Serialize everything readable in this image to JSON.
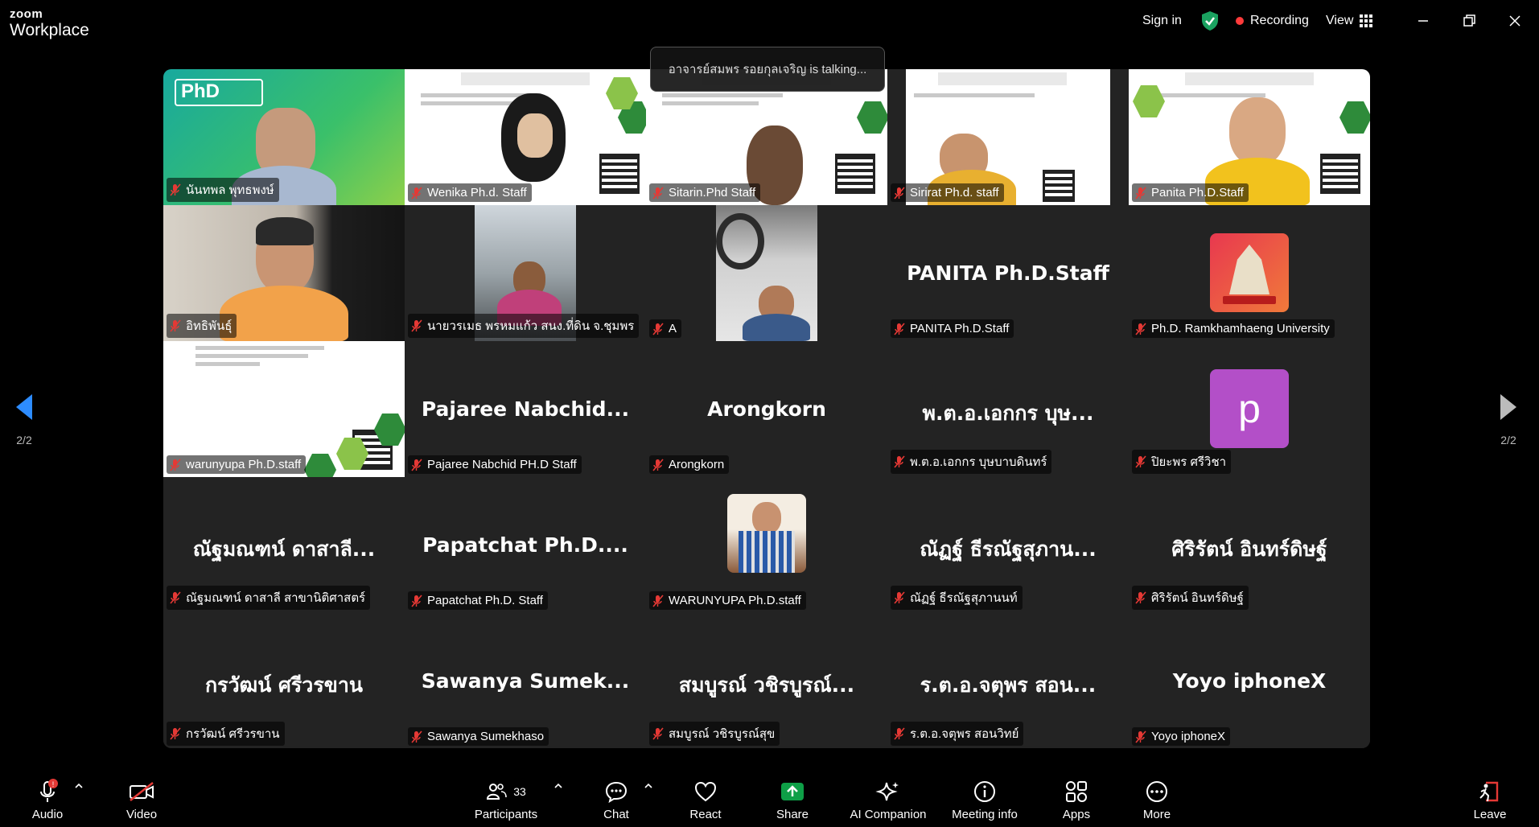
{
  "app": {
    "brand_top": "zoom",
    "brand_bottom": "Workplace"
  },
  "header": {
    "sign_in": "Sign in",
    "recording": "Recording",
    "view": "View"
  },
  "toast": {
    "text": "อาจารย์สมพร รอยกุลเจริญ is talking..."
  },
  "pagination": {
    "left": "2/2",
    "right": "2/2"
  },
  "tiles": [
    {
      "label": "นันทพล พุทธพงษ์",
      "title": ""
    },
    {
      "label": "Wenika Ph.d. Staff",
      "title": ""
    },
    {
      "label": "Sitarin.Phd Staff",
      "title": ""
    },
    {
      "label": "Sirirat Ph.d. staff",
      "title": ""
    },
    {
      "label": "Panita Ph.D.Staff",
      "title": ""
    },
    {
      "label": "อิทธิพันธุ์",
      "title": ""
    },
    {
      "label": "นายวรเมธ พรหมแก้ว สนง.ที่ดิน จ.ชุมพร",
      "title": ""
    },
    {
      "label": "A",
      "title": ""
    },
    {
      "label": "PANITA Ph.D.Staff",
      "title": "PANITA Ph.D.Staff"
    },
    {
      "label": "Ph.D. Ramkhamhaeng University",
      "title": ""
    },
    {
      "label": "warunyupa Ph.D.staff",
      "title": ""
    },
    {
      "label": "Pajaree Nabchid PH.D Staff",
      "title": "Pajaree  Nabchid..."
    },
    {
      "label": "Arongkorn",
      "title": "Arongkorn"
    },
    {
      "label": "พ.ต.อ.เอกกร บุษบาบดินทร์",
      "title": "พ.ต.อ.เอกกร บุษ..."
    },
    {
      "label": "ปิยะพร ศรีวิชา",
      "title": "",
      "avatar_letter": "p"
    },
    {
      "label": "ณัฐมณฑน์ ดาสาลี สาขานิติศาสตร์",
      "title": "ณัฐมณฑน์ ดาสาลี..."
    },
    {
      "label": "Papatchat Ph.D. Staff",
      "title": "Papatchat  Ph.D...."
    },
    {
      "label": "WARUNYUPA Ph.D.staff",
      "title": ""
    },
    {
      "label": "ณัฏฐ์ ธีรณัฐสุภานนท์",
      "title": "ณัฏฐ์  ธีรณัฐสุภาน..."
    },
    {
      "label": "ศิริรัตน์ อินทร์ดิษฐ์",
      "title": "ศิริรัตน์ อินทร์ดิษฐ์"
    },
    {
      "label": "กรวัฒน์ ศรีวรขาน",
      "title": "กรวัฒน์ ศรีวรขาน"
    },
    {
      "label": "Sawanya Sumekhaso",
      "title": "Sawanya  Sumek..."
    },
    {
      "label": "สมบูรณ์ วชิรบูรณ์สุข",
      "title": "สมบูรณ์ วชิรบูรณ์..."
    },
    {
      "label": "ร.ต.อ.จตุพร สอนวิทย์",
      "title": "ร.ต.อ.จตุพร  สอน..."
    },
    {
      "label": "Yoyo iphoneX",
      "title": "Yoyo iphoneX"
    }
  ],
  "toolbar": {
    "audio": "Audio",
    "video": "Video",
    "participants": "Participants",
    "participants_count": "33",
    "chat": "Chat",
    "react": "React",
    "share": "Share",
    "ai_companion": "AI Companion",
    "meeting_info": "Meeting info",
    "apps": "Apps",
    "more": "More",
    "leave": "Leave"
  },
  "colors": {
    "gallery_bg": "#232323",
    "share_green": "#0e9f47",
    "recording_red": "#ff3b3b",
    "shield_green": "#1aa260",
    "avatar_purple": "#b34fc8"
  }
}
